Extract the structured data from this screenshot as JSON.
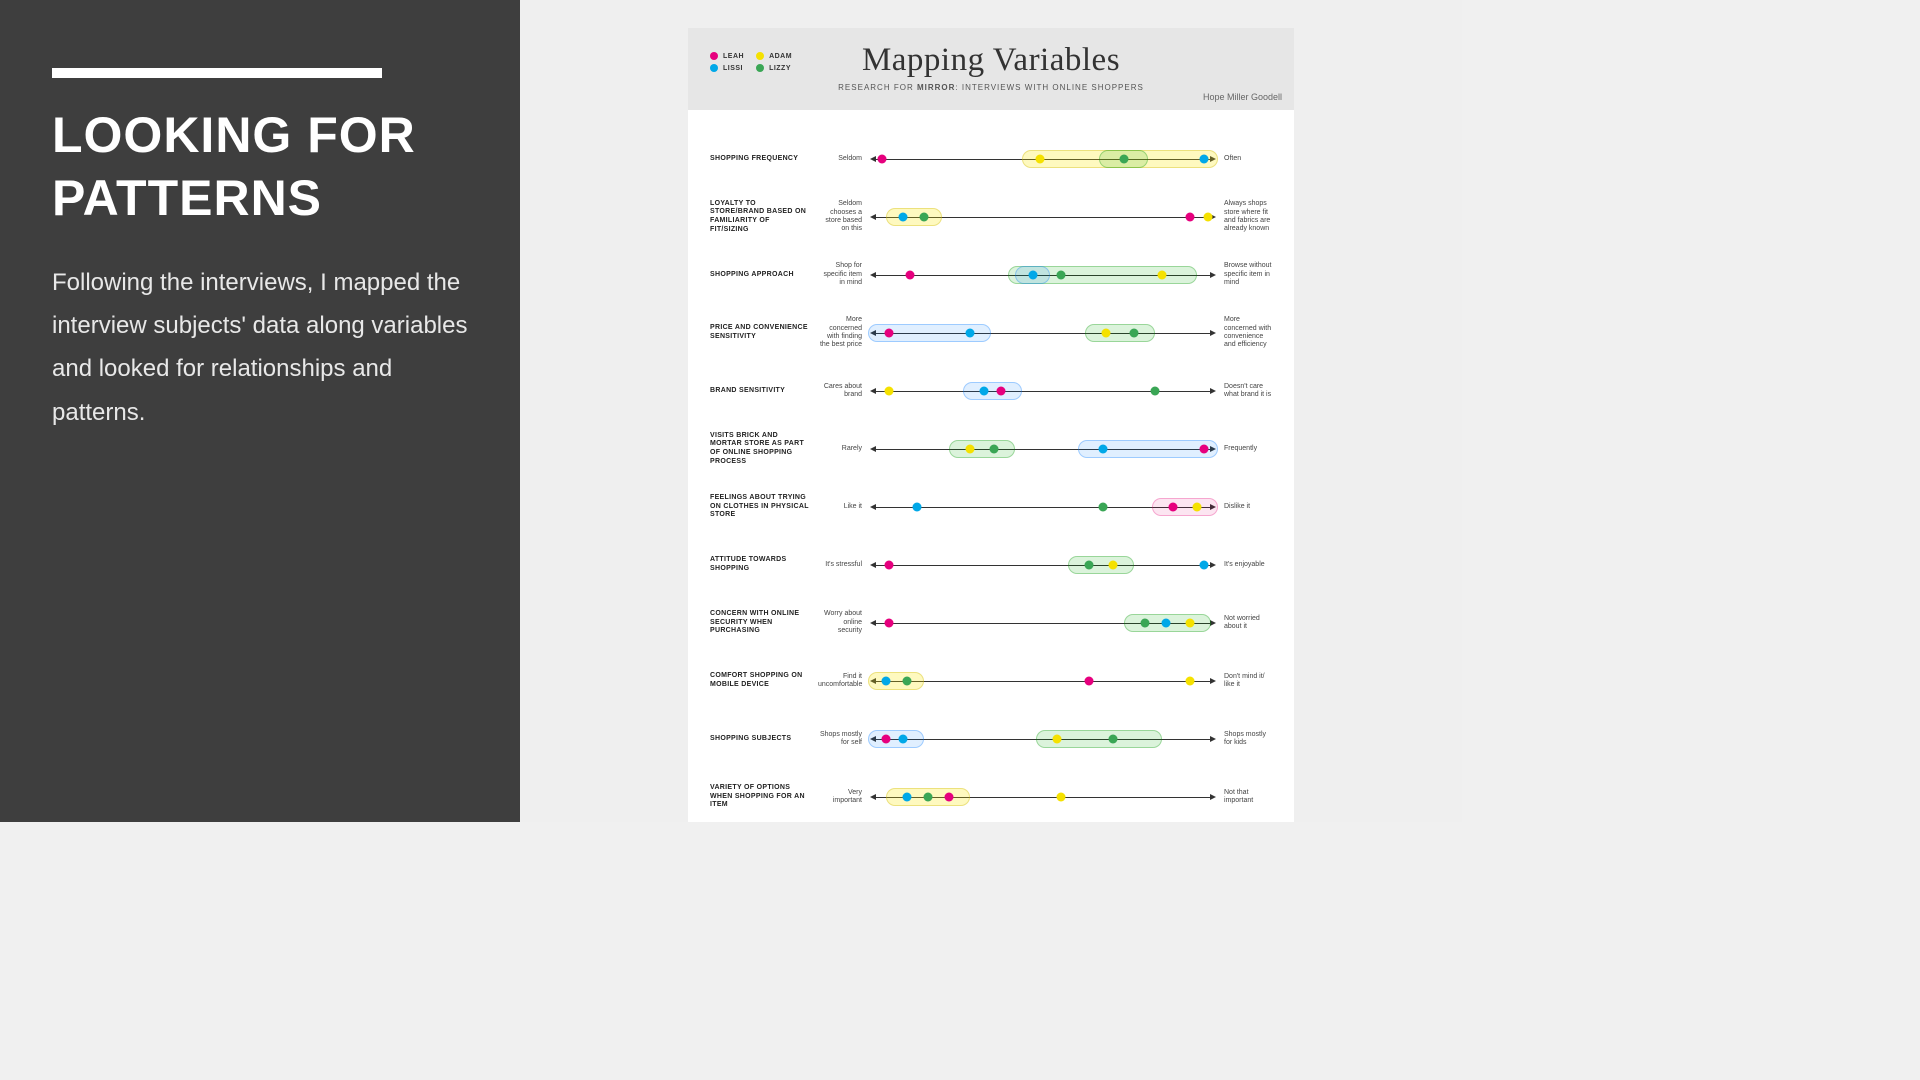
{
  "left": {
    "heading_l1": "LOOKING FOR",
    "heading_l2": "PATTERNS",
    "body": "Following the interviews, I mapped the interview subjects' data along variables and looked for relationships and patterns."
  },
  "poster": {
    "title": "Mapping Variables",
    "subtitle_prefix": "RESEARCH FOR ",
    "subtitle_bold": "MIRROR",
    "subtitle_suffix": ": INTERVIEWS WITH ONLINE SHOPPERS",
    "author": "Hope Miller Goodell",
    "legend": [
      {
        "key": "leah",
        "label": "LEAH",
        "color": "#e6007e"
      },
      {
        "key": "adam",
        "label": "ADAM",
        "color": "#f5e100"
      },
      {
        "key": "lissi",
        "label": "LISSI",
        "color": "#00a8e8"
      },
      {
        "key": "lizzy",
        "label": "LIZZY",
        "color": "#3aa655"
      }
    ]
  },
  "chart_data": {
    "type": "scatter",
    "note": "Each variable is a horizontal continuum (0=left end, 100=right end). Dot positions are percentage estimates read from the figure. Groups are highlight ovals.",
    "people": {
      "leah": "#e6007e",
      "lissi": "#00a8e8",
      "adam": "#f5e100",
      "lizzy": "#3aa655"
    },
    "variables": [
      {
        "label": "SHOPPING FREQUENCY",
        "left_end": "Seldom",
        "right_end": "Often",
        "dots": {
          "leah": 4,
          "adam": 49,
          "lizzy": 73,
          "lissi": 96
        },
        "groups": [
          {
            "class": "g-yellow",
            "from": 44,
            "to": 100
          },
          {
            "class": "g-green",
            "from": 66,
            "to": 80
          }
        ]
      },
      {
        "label": "LOYALTY TO STORE/BRAND BASED ON FAMILIARITY OF FIT/SIZING",
        "left_end": "Seldom chooses a store based on this",
        "right_end": "Always shops store where fit and fabrics are already known",
        "dots": {
          "lissi": 10,
          "lizzy": 16,
          "leah": 92,
          "adam": 97
        },
        "groups": [
          {
            "class": "g-yellow",
            "from": 5,
            "to": 21
          }
        ]
      },
      {
        "label": "SHOPPING APPROACH",
        "left_end": "Shop for specific item in mind",
        "right_end": "Browse without specific item in mind",
        "dots": {
          "leah": 12,
          "lissi": 47,
          "lizzy": 55,
          "adam": 84
        },
        "groups": [
          {
            "class": "g-green",
            "from": 40,
            "to": 94
          },
          {
            "class": "g-blue",
            "from": 42,
            "to": 52
          }
        ]
      },
      {
        "label": "PRICE AND CONVENIENCE SENSITIVITY",
        "left_end": "More concerned with finding the best price",
        "right_end": "More concerned with convenience and efficiency",
        "dots": {
          "leah": 6,
          "lissi": 29,
          "adam": 68,
          "lizzy": 76
        },
        "groups": [
          {
            "class": "g-blue",
            "from": 0,
            "to": 35
          },
          {
            "class": "g-green",
            "from": 62,
            "to": 82
          }
        ]
      },
      {
        "label": "BRAND SENSITIVITY",
        "left_end": "Cares about brand",
        "right_end": "Doesn't care what brand it is",
        "dots": {
          "adam": 6,
          "lissi": 33,
          "leah": 38,
          "lizzy": 82
        },
        "groups": [
          {
            "class": "g-blue",
            "from": 27,
            "to": 44
          }
        ]
      },
      {
        "label": "VISITS BRICK AND MORTAR STORE AS PART OF ONLINE SHOPPING PROCESS",
        "left_end": "Rarely",
        "right_end": "Frequently",
        "dots": {
          "adam": 29,
          "lizzy": 36,
          "lissi": 67,
          "leah": 96
        },
        "groups": [
          {
            "class": "g-green",
            "from": 23,
            "to": 42
          },
          {
            "class": "g-blue",
            "from": 60,
            "to": 100
          }
        ]
      },
      {
        "label": "FEELINGS ABOUT TRYING ON CLOTHES IN PHYSICAL STORE",
        "left_end": "Like it",
        "right_end": "Dislike it",
        "dots": {
          "lissi": 14,
          "lizzy": 67,
          "leah": 87,
          "adam": 94
        },
        "groups": [
          {
            "class": "g-pink",
            "from": 81,
            "to": 100
          }
        ]
      },
      {
        "label": "ATTITUDE TOWARDS SHOPPING",
        "left_end": "It's stressful",
        "right_end": "It's enjoyable",
        "dots": {
          "leah": 6,
          "lizzy": 63,
          "adam": 70,
          "lissi": 96
        },
        "groups": [
          {
            "class": "g-green",
            "from": 57,
            "to": 76
          }
        ]
      },
      {
        "label": "CONCERN WITH ONLINE SECURITY WHEN PURCHASING",
        "left_end": "Worry about online security",
        "right_end": "Not worried about it",
        "dots": {
          "leah": 6,
          "lizzy": 79,
          "lissi": 85,
          "adam": 92
        },
        "groups": [
          {
            "class": "g-green",
            "from": 73,
            "to": 98
          }
        ]
      },
      {
        "label": "COMFORT SHOPPING ON MOBILE DEVICE",
        "left_end": "Find it uncomfortable",
        "right_end": "Don't mind it/ like it",
        "dots": {
          "lissi": 5,
          "lizzy": 11,
          "leah": 63,
          "adam": 92
        },
        "groups": [
          {
            "class": "g-yellow",
            "from": 0,
            "to": 16
          }
        ]
      },
      {
        "label": "SHOPPING SUBJECTS",
        "left_end": "Shops mostly for self",
        "right_end": "Shops mostly for kids",
        "dots": {
          "leah": 5,
          "lissi": 10,
          "adam": 54,
          "lizzy": 70
        },
        "groups": [
          {
            "class": "g-blue",
            "from": 0,
            "to": 16
          },
          {
            "class": "g-green",
            "from": 48,
            "to": 84
          }
        ]
      },
      {
        "label": "VARIETY OF OPTIONS WHEN SHOPPING FOR AN ITEM",
        "left_end": "Very important",
        "right_end": "Not that important",
        "dots": {
          "lissi": 11,
          "lizzy": 17,
          "leah": 23,
          "adam": 55
        },
        "groups": [
          {
            "class": "g-yellow",
            "from": 5,
            "to": 29
          }
        ]
      }
    ]
  }
}
